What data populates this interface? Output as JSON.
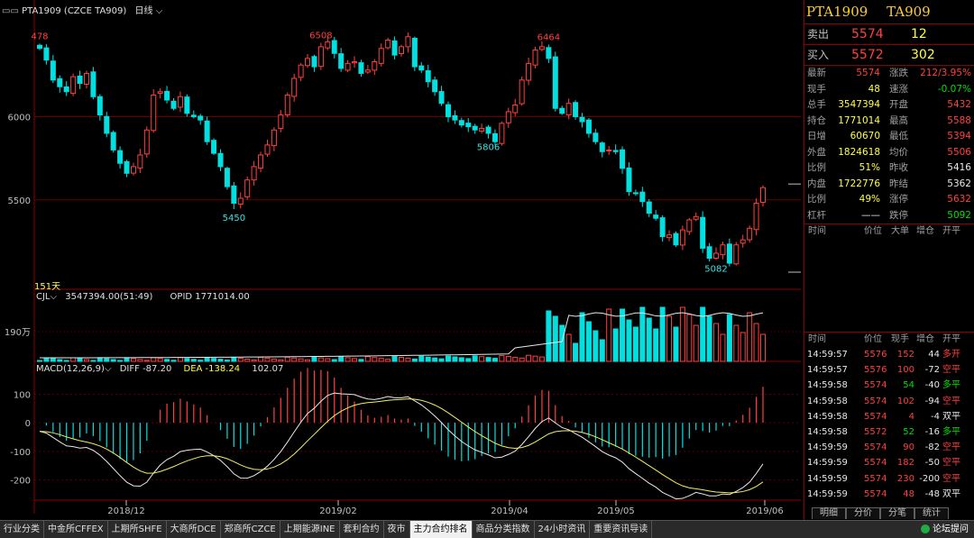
{
  "header": {
    "symbol": "PTA1909 (CZCE TA909)",
    "period_label": "日线"
  },
  "price_panel": {
    "y_labels": [
      "6000",
      "5500"
    ],
    "annotations": [
      {
        "label": "478",
        "color": "#ff4040"
      },
      {
        "label": "6508",
        "color": "#ff4040"
      },
      {
        "label": "6464",
        "color": "#ff4040"
      },
      {
        "label": "5806",
        "color": "#40e0e0"
      },
      {
        "label": "5450",
        "color": "#40e0e0"
      },
      {
        "label": "5082",
        "color": "#40e0e0"
      }
    ],
    "days_label": "151天"
  },
  "volume_panel": {
    "indicator": "CJL",
    "value_text": "3547394.00(51:49)",
    "opid_text": "OPID 1771014.00",
    "y_label": "190万"
  },
  "macd_panel": {
    "indicator": "MACD(12,26,9)",
    "diff_text": "DIFF -87.20",
    "dea_text": "DEA -138.24",
    "macd_text": "102.07",
    "y_labels": [
      "100",
      "0",
      "-100",
      "-200"
    ]
  },
  "x_axis": [
    "2018/12",
    "2019/02",
    "2019/04",
    "2019/05",
    "2019/06"
  ],
  "chart_data": {
    "type": "candlestick",
    "title": "PTA1909 (CZCE TA909) 日线",
    "series": [
      {
        "name": "price",
        "ylim": [
          5050,
          6560
        ],
        "close": [
          6410,
          6340,
          6220,
          6180,
          6150,
          6240,
          6200,
          6260,
          6120,
          6010,
          5900,
          5800,
          5720,
          5660,
          5700,
          5770,
          5920,
          6130,
          6150,
          6100,
          6050,
          6120,
          6020,
          6000,
          5980,
          5850,
          5780,
          5700,
          5580,
          5480,
          5510,
          5620,
          5700,
          5770,
          5830,
          5920,
          6010,
          6130,
          6230,
          6310,
          6350,
          6300,
          6420,
          6450,
          6380,
          6290,
          6320,
          6330,
          6260,
          6280,
          6330,
          6410,
          6460,
          6370,
          6420,
          6480,
          6300,
          6280,
          6210,
          6150,
          6080,
          6000,
          5980,
          5950,
          5940,
          5920,
          5930,
          5900,
          5850,
          5960,
          6030,
          6070,
          6220,
          6320,
          6400,
          6420,
          6350,
          6050,
          6020,
          6080,
          6000,
          5970,
          5900,
          5850,
          5790,
          5800,
          5790,
          5690,
          5550,
          5540,
          5490,
          5420,
          5390,
          5280,
          5290,
          5230,
          5320,
          5380,
          5400,
          5210,
          5150,
          5180,
          5230,
          5120,
          5230,
          5260,
          5330,
          5480,
          5574
        ]
      },
      {
        "name": "CJL",
        "unit": "万",
        "max": 300
      },
      {
        "name": "MACD",
        "ylim": [
          -270,
          170
        ],
        "DIFF": -87.2,
        "DEA": -138.24,
        "MACD": 102.07
      }
    ],
    "x_ticks": [
      "2018/12",
      "2019/02",
      "2019/04",
      "2019/05",
      "2019/06"
    ]
  },
  "right_panel": {
    "title_main": "PTA1909",
    "title_code": "TA909",
    "sell": {
      "label": "卖出",
      "price": "5574",
      "vol": "12"
    },
    "buy": {
      "label": "买入",
      "price": "5572",
      "vol": "302"
    },
    "quote_rows": [
      {
        "l1": "最新",
        "v1": "5574",
        "c1": "red",
        "l2": "涨跌",
        "v2": "212/3.95%",
        "c2": "red"
      },
      {
        "l1": "现手",
        "v1": "48",
        "c1": "yellow",
        "l2": "速涨",
        "v2": "-0.07%",
        "c2": "green"
      },
      {
        "l1": "总手",
        "v1": "3547394",
        "c1": "yellow",
        "l2": "开盘",
        "v2": "5432",
        "c2": "red"
      },
      {
        "l1": "持仓",
        "v1": "1771014",
        "c1": "yellow",
        "l2": "最高",
        "v2": "5588",
        "c2": "red"
      },
      {
        "l1": "日增",
        "v1": "60670",
        "c1": "yellow",
        "l2": "最低",
        "v2": "5394",
        "c2": "red"
      },
      {
        "l1": "外盘",
        "v1": "1824618",
        "c1": "yellow",
        "l2": "均价",
        "v2": "5506",
        "c2": "red"
      },
      {
        "l1": "比例",
        "v1": "51%",
        "c1": "yellow",
        "l2": "昨收",
        "v2": "5416",
        "c2": "white"
      },
      {
        "l1": "内盘",
        "v1": "1722776",
        "c1": "yellow",
        "l2": "昨结",
        "v2": "5362",
        "c2": "white"
      },
      {
        "l1": "比例",
        "v1": "49%",
        "c1": "yellow",
        "l2": "涨停",
        "v2": "5632",
        "c2": "red"
      },
      {
        "l1": "杠杆",
        "v1": "——",
        "c1": "white",
        "l2": "跌停",
        "v2": "5092",
        "c2": "green"
      }
    ],
    "big_header": {
      "time": "时间",
      "price": "价位",
      "big": "大单",
      "inc": "增仓",
      "oc": "开平"
    },
    "tick_header": {
      "time": "时间",
      "price": "价位",
      "vol": "现手",
      "inc": "增仓",
      "oc": "开平"
    },
    "ticks": [
      {
        "time": "14:59:57",
        "price": "5576",
        "pc": "red",
        "vol": "152",
        "vc": "red",
        "inc": "44",
        "oc": "多开",
        "occ": "red"
      },
      {
        "time": "14:59:57",
        "price": "5576",
        "pc": "red",
        "vol": "100",
        "vc": "red",
        "inc": "-72",
        "oc": "空平",
        "occ": "red"
      },
      {
        "time": "14:59:58",
        "price": "5574",
        "pc": "red",
        "vol": "54",
        "vc": "green",
        "inc": "-40",
        "oc": "多平",
        "occ": "green"
      },
      {
        "time": "14:59:58",
        "price": "5574",
        "pc": "red",
        "vol": "102",
        "vc": "red",
        "inc": "-94",
        "oc": "空平",
        "occ": "red"
      },
      {
        "time": "14:59:58",
        "price": "5574",
        "pc": "red",
        "vol": "4",
        "vc": "red",
        "inc": "-4",
        "oc": "双平",
        "occ": "white"
      },
      {
        "time": "14:59:58",
        "price": "5572",
        "pc": "red",
        "vol": "52",
        "vc": "green",
        "inc": "-16",
        "oc": "多平",
        "occ": "green"
      },
      {
        "time": "14:59:59",
        "price": "5574",
        "pc": "red",
        "vol": "90",
        "vc": "red",
        "inc": "-82",
        "oc": "空平",
        "occ": "red"
      },
      {
        "time": "14:59:59",
        "price": "5574",
        "pc": "red",
        "vol": "182",
        "vc": "red",
        "inc": "-50",
        "oc": "空平",
        "occ": "red"
      },
      {
        "time": "14:59:59",
        "price": "5574",
        "pc": "red",
        "vol": "230",
        "vc": "red",
        "inc": "-200",
        "oc": "空平",
        "occ": "red"
      },
      {
        "time": "14:59:59",
        "price": "5574",
        "pc": "red",
        "vol": "48",
        "vc": "red",
        "inc": "-48",
        "oc": "双平",
        "occ": "white"
      }
    ],
    "tabs": [
      "明细",
      "分价",
      "分笔",
      "统计"
    ]
  },
  "bottom_tabs": [
    "行业分类",
    "中金所CFFEX",
    "上期所SHFE",
    "大商所DCE",
    "郑商所CZCE",
    "上期能源INE",
    "套利合约",
    "夜市",
    "主力合约排名",
    "商品分类指数",
    "24小时资讯",
    "重要资讯导读"
  ],
  "active_tab_index": 8,
  "brand": "论坛提问",
  "colors": {
    "up": "#ff4040",
    "down": "#00e0e0",
    "grid": "#8b0000",
    "line": "#e8e8e8",
    "signal": "#f0f060"
  }
}
